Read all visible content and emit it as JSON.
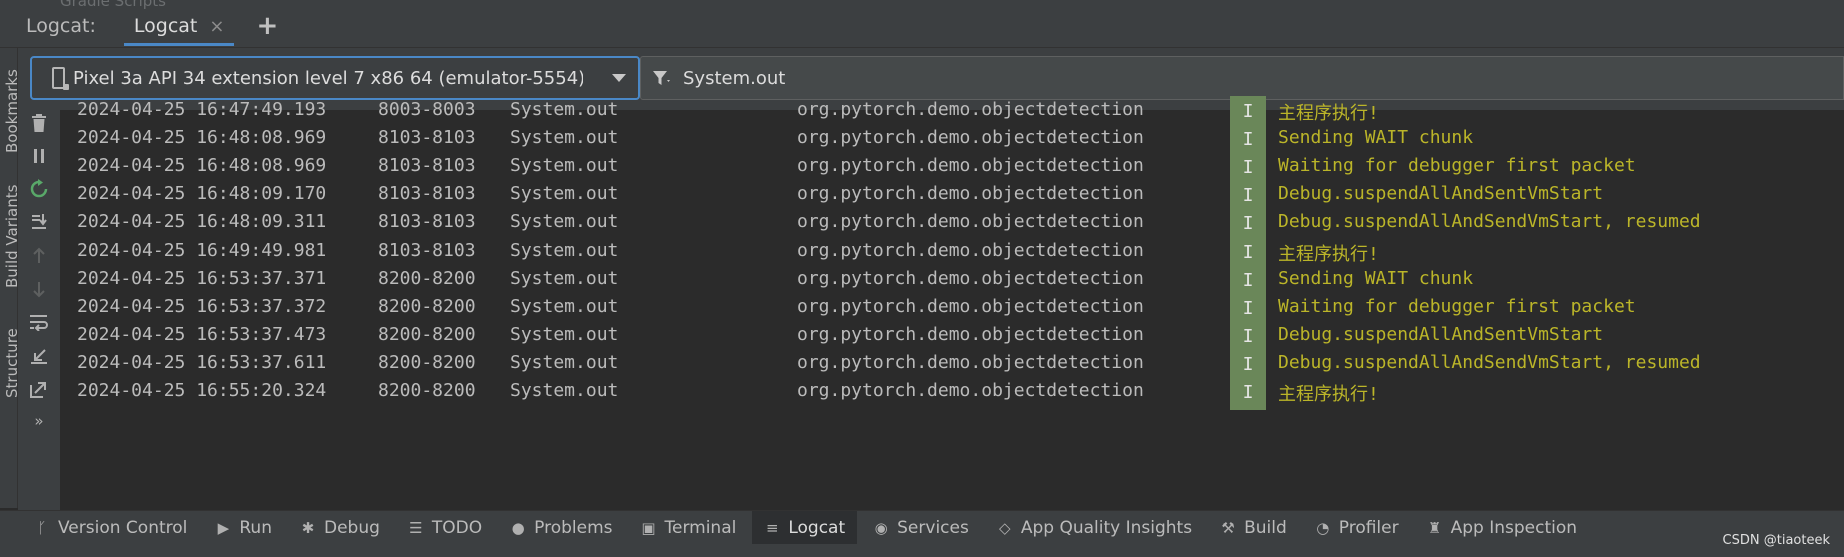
{
  "header": {
    "ghost_text": "Gradle Scripts",
    "logcat_label": "Logcat:",
    "tab_label": "Logcat",
    "tab_close": "×",
    "add_tab": "+"
  },
  "left_strip": {
    "items": [
      "Bookmarks",
      "Build Variants",
      "Structure"
    ]
  },
  "filter": {
    "device": "Pixel 3a API 34 extension level 7 x86 64 (emulator-5554) Ar",
    "query": "System.out"
  },
  "toolbar": {
    "more": "»"
  },
  "logs": [
    {
      "date": "2024-04-25 16:47:49.193",
      "pid": "8003-8003",
      "tag": "System.out",
      "pkg": "org.pytorch.demo.objectdetection",
      "level": "I",
      "msg": "主程序执行!"
    },
    {
      "date": "2024-04-25 16:48:08.969",
      "pid": "8103-8103",
      "tag": "System.out",
      "pkg": "org.pytorch.demo.objectdetection",
      "level": "I",
      "msg": "Sending WAIT chunk"
    },
    {
      "date": "2024-04-25 16:48:08.969",
      "pid": "8103-8103",
      "tag": "System.out",
      "pkg": "org.pytorch.demo.objectdetection",
      "level": "I",
      "msg": "Waiting for debugger first packet"
    },
    {
      "date": "2024-04-25 16:48:09.170",
      "pid": "8103-8103",
      "tag": "System.out",
      "pkg": "org.pytorch.demo.objectdetection",
      "level": "I",
      "msg": "Debug.suspendAllAndSentVmStart"
    },
    {
      "date": "2024-04-25 16:48:09.311",
      "pid": "8103-8103",
      "tag": "System.out",
      "pkg": "org.pytorch.demo.objectdetection",
      "level": "I",
      "msg": "Debug.suspendAllAndSendVmStart, resumed"
    },
    {
      "date": "2024-04-25 16:49:49.981",
      "pid": "8103-8103",
      "tag": "System.out",
      "pkg": "org.pytorch.demo.objectdetection",
      "level": "I",
      "msg": "主程序执行!"
    },
    {
      "date": "2024-04-25 16:53:37.371",
      "pid": "8200-8200",
      "tag": "System.out",
      "pkg": "org.pytorch.demo.objectdetection",
      "level": "I",
      "msg": "Sending WAIT chunk"
    },
    {
      "date": "2024-04-25 16:53:37.372",
      "pid": "8200-8200",
      "tag": "System.out",
      "pkg": "org.pytorch.demo.objectdetection",
      "level": "I",
      "msg": "Waiting for debugger first packet"
    },
    {
      "date": "2024-04-25 16:53:37.473",
      "pid": "8200-8200",
      "tag": "System.out",
      "pkg": "org.pytorch.demo.objectdetection",
      "level": "I",
      "msg": "Debug.suspendAllAndSentVmStart"
    },
    {
      "date": "2024-04-25 16:53:37.611",
      "pid": "8200-8200",
      "tag": "System.out",
      "pkg": "org.pytorch.demo.objectdetection",
      "level": "I",
      "msg": "Debug.suspendAllAndSendVmStart, resumed"
    },
    {
      "date": "2024-04-25 16:55:20.324",
      "pid": "8200-8200",
      "tag": "System.out",
      "pkg": "org.pytorch.demo.objectdetection",
      "level": "I",
      "msg": "主程序执行!"
    }
  ],
  "bottom": {
    "items": [
      {
        "label": "Version Control",
        "icon": "branch-icon",
        "glyph": "ᚴ"
      },
      {
        "label": "Run",
        "icon": "run-icon",
        "glyph": "▶"
      },
      {
        "label": "Debug",
        "icon": "bug-icon",
        "glyph": "✱"
      },
      {
        "label": "TODO",
        "icon": "todo-list-icon",
        "glyph": "☰"
      },
      {
        "label": "Problems",
        "icon": "problems-icon",
        "glyph": "●"
      },
      {
        "label": "Terminal",
        "icon": "terminal-icon",
        "glyph": "▣"
      },
      {
        "label": "Logcat",
        "icon": "logcat-icon",
        "glyph": "≡"
      },
      {
        "label": "Services",
        "icon": "services-icon",
        "glyph": "◉"
      },
      {
        "label": "App Quality Insights",
        "icon": "diamond-icon",
        "glyph": "◇"
      },
      {
        "label": "Build",
        "icon": "hammer-icon",
        "glyph": "⚒"
      },
      {
        "label": "Profiler",
        "icon": "gauge-icon",
        "glyph": "◔"
      },
      {
        "label": "App Inspection",
        "icon": "inspection-icon",
        "glyph": "♜"
      }
    ],
    "active": "Logcat"
  },
  "watermark": "CSDN @tiaoteek",
  "colors": {
    "accent": "#4a88c7",
    "info_badge": "#6a8759",
    "message": "#bbb529",
    "background": "#2b2b2b",
    "panel": "#3c3f41"
  }
}
